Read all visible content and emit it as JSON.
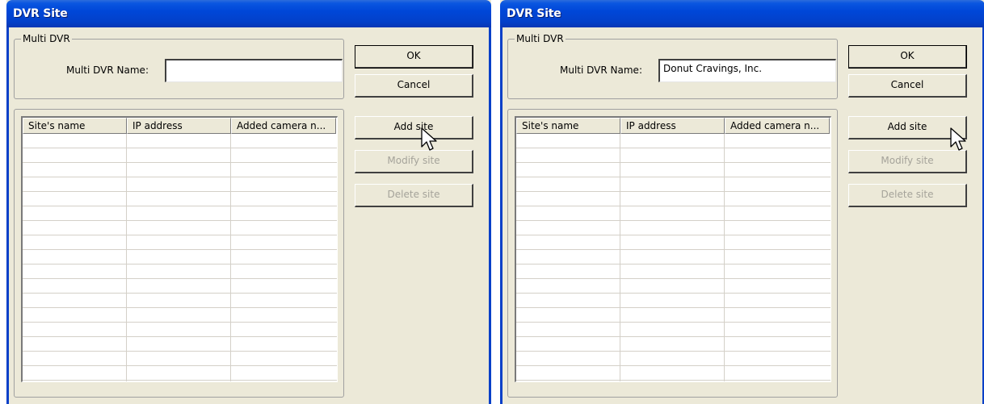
{
  "dialogs": [
    {
      "title": "DVR Site",
      "group_label": "Multi DVR",
      "name_label": "Multi DVR Name:",
      "name_value": "",
      "columns": [
        "Site's name",
        "IP address",
        "Added camera n..."
      ],
      "buttons": {
        "ok": "OK",
        "cancel": "Cancel",
        "add_site": "Add site",
        "modify_site": "Modify site",
        "delete_site": "Delete site"
      }
    },
    {
      "title": "DVR Site",
      "group_label": "Multi DVR",
      "name_label": "Multi DVR Name:",
      "name_value": "Donut Cravings, Inc.",
      "columns": [
        "Site's name",
        "IP address",
        "Added camera n..."
      ],
      "buttons": {
        "ok": "OK",
        "cancel": "Cancel",
        "add_site": "Add site",
        "modify_site": "Modify site",
        "delete_site": "Delete site"
      }
    }
  ],
  "colors": {
    "titlebar": "#0347d8",
    "dialog_bg": "#ece9d8",
    "disabled_text": "#a5a39a"
  },
  "icons": [
    "mouse-pointer-icon"
  ]
}
